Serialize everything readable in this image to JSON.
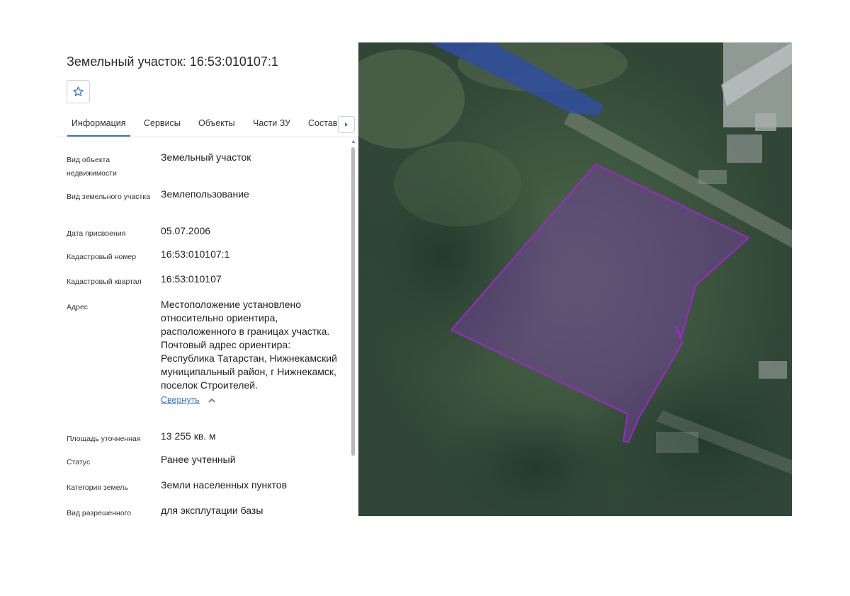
{
  "title": "Земельный участок: 16:53:010107:1",
  "tabs": [
    {
      "label": "Информация"
    },
    {
      "label": "Сервисы"
    },
    {
      "label": "Объекты"
    },
    {
      "label": "Части ЗУ"
    },
    {
      "label": "Состав"
    }
  ],
  "icons": {
    "favorite": "star-icon",
    "next_tab": "chevron-right-icon",
    "collapse": "chevron-up-icon"
  },
  "colors": {
    "accent": "#3a73c4",
    "parcel_outline": "#a026c8",
    "parcel_fill": "#7a3ca8",
    "water": "#2f4ea0"
  },
  "fields": [
    {
      "label": "Вид объекта недвижимости",
      "value": "Земельный участок"
    },
    {
      "label": "Вид земельного участка",
      "value": "Землепользование"
    },
    {
      "label": "Дата присвоения",
      "value": "05.07.2006"
    },
    {
      "label": "Кадастровый номер",
      "value": "16:53:010107:1"
    },
    {
      "label": "Кадастровый квартал",
      "value": "16:53:010107"
    },
    {
      "label": "Адрес",
      "value": "Местоположение установлено относительно ориентира, расположенного в границах участка. Почтовый адрес ориентира: Республика Татарстан, Нижнекамский муниципальный район, г Нижнекамск, поселок Строителей.",
      "link": "Свернуть"
    },
    {
      "label": "Площадь уточненная",
      "value": "13 255 кв. м"
    },
    {
      "label": "Статус",
      "value": "Ранее учтенный"
    },
    {
      "label": "Категория земель",
      "value": "Земли населенных пунктов"
    },
    {
      "label": "Вид разрешенного",
      "value": "для эксплутации базы"
    }
  ]
}
